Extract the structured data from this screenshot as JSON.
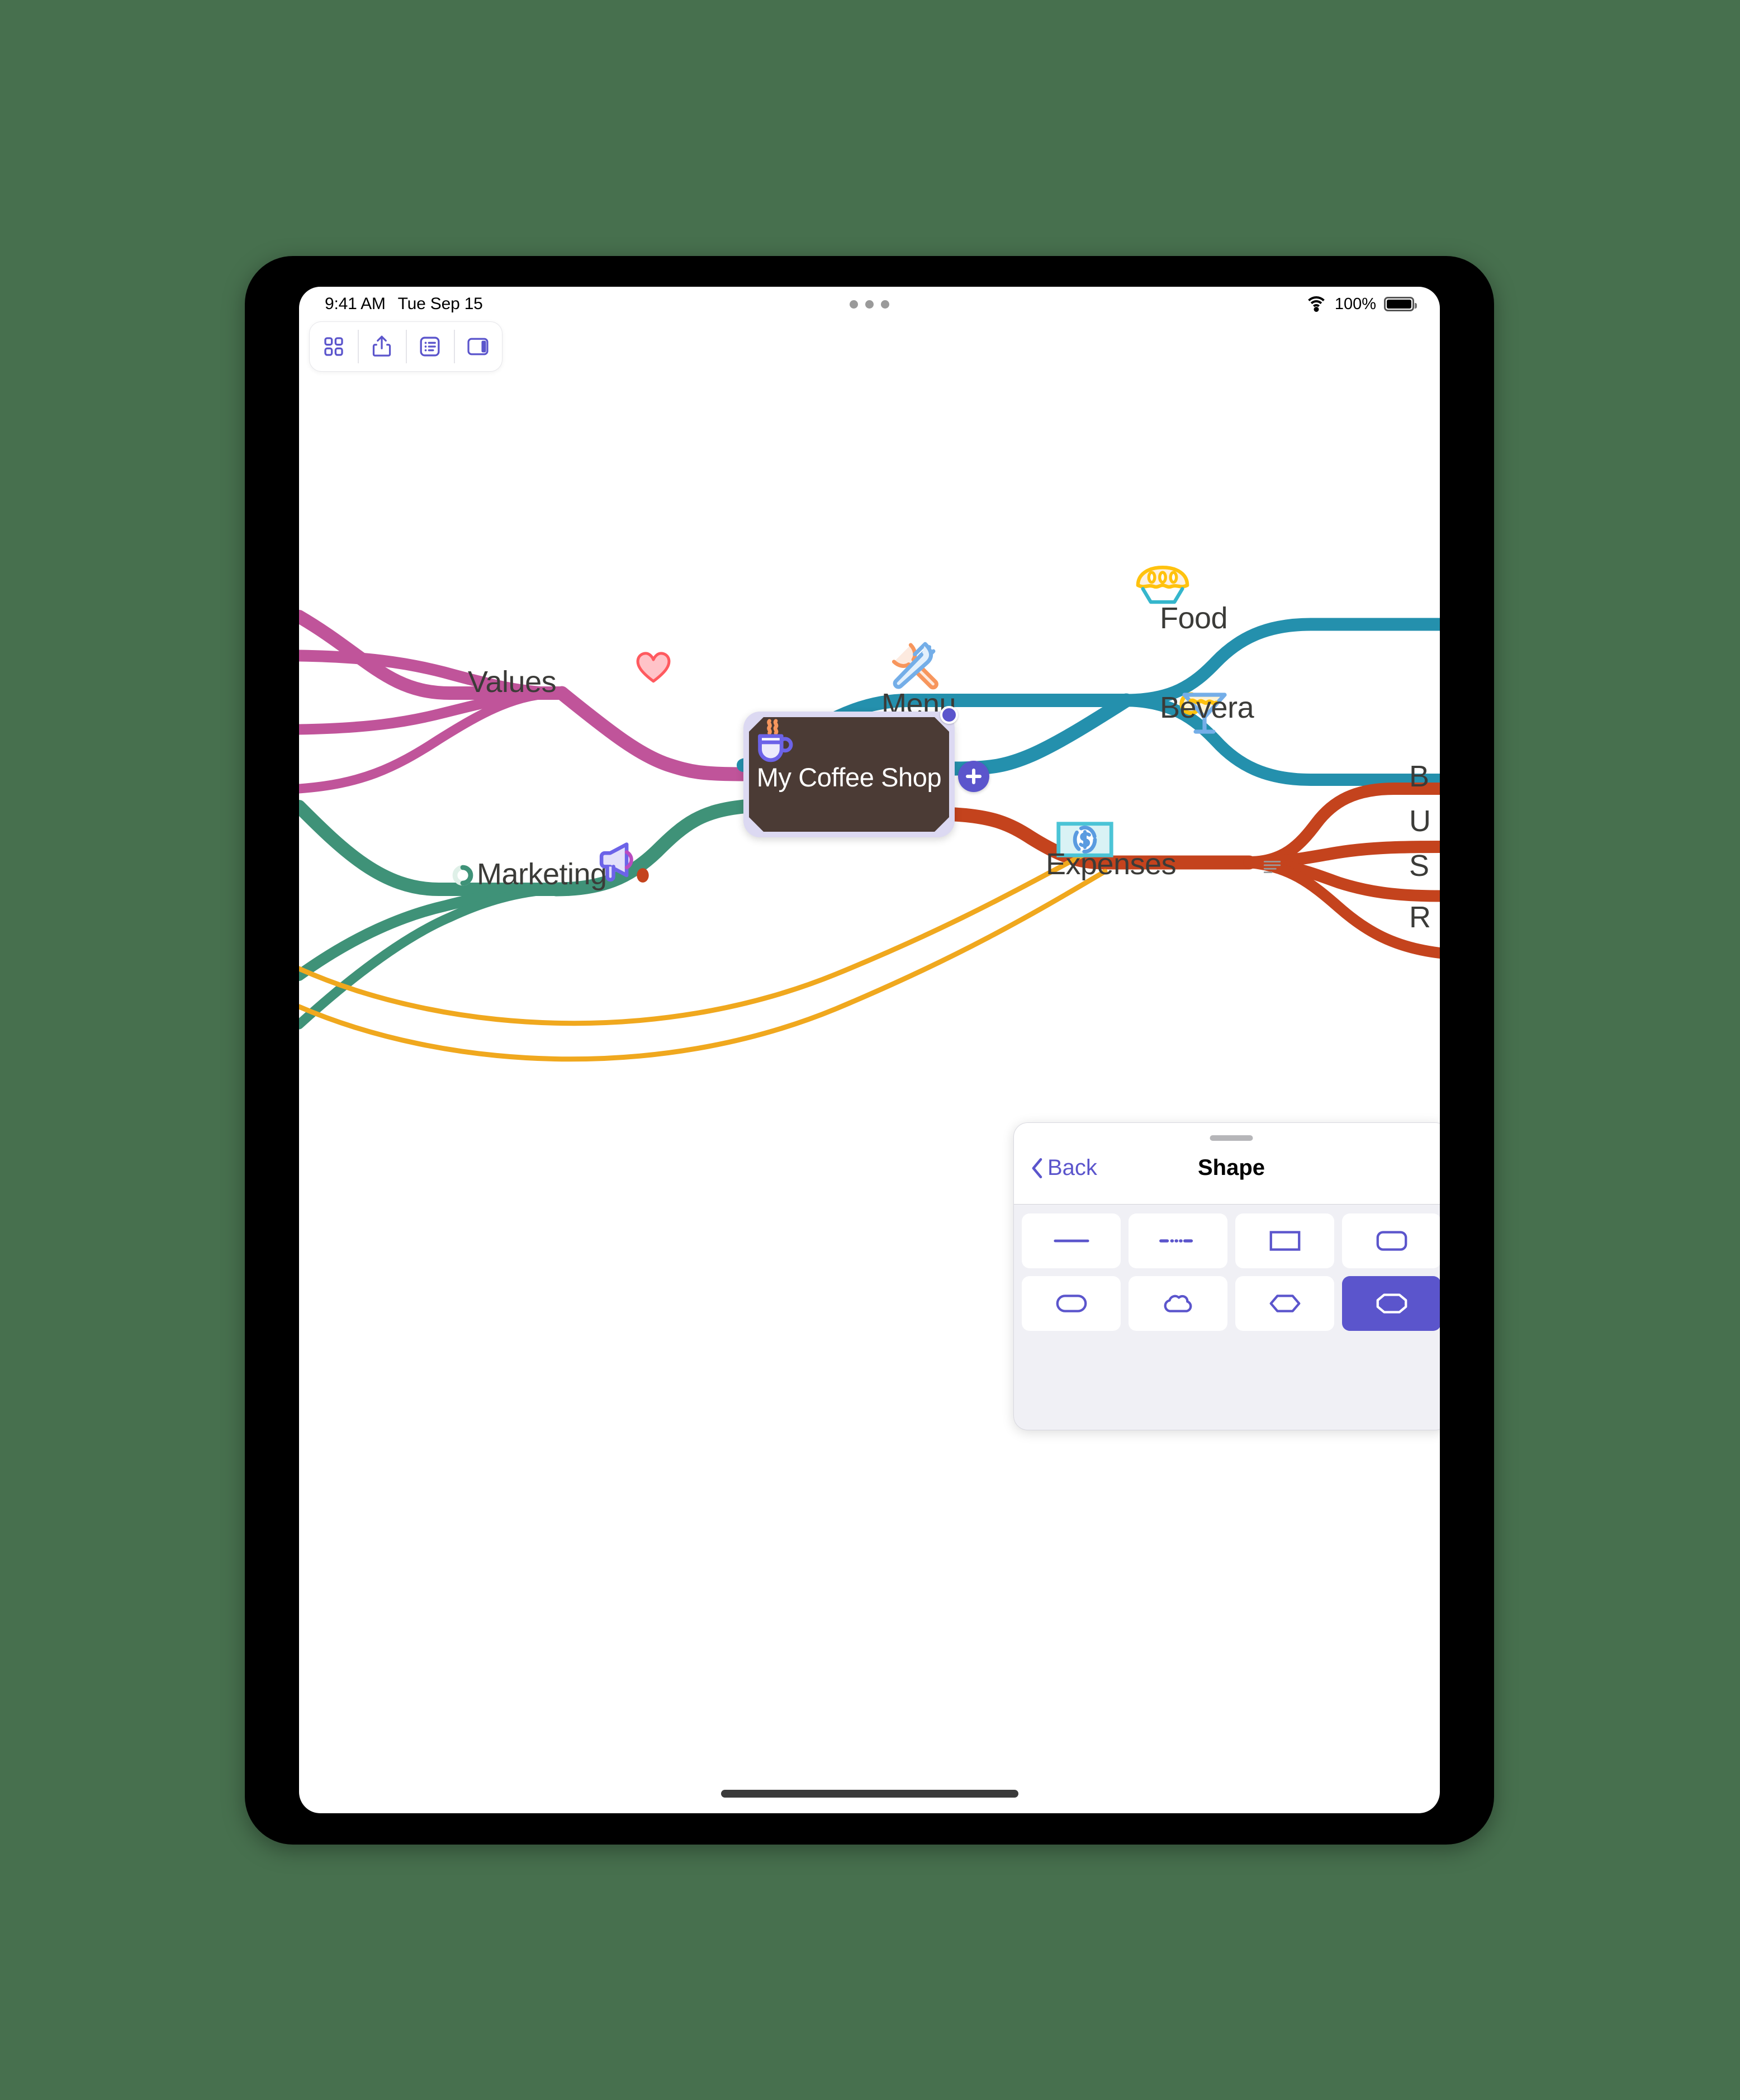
{
  "status_bar": {
    "time": "9:41 AM",
    "date": "Tue Sep 15",
    "battery_percent": "100%",
    "wifi_icon": "wifi-icon",
    "battery_icon": "battery-icon",
    "multitask_icon": "multitask-dots-icon"
  },
  "toolbar": {
    "items": [
      {
        "name": "documents-grid-button",
        "icon": "grid-icon"
      },
      {
        "name": "share-button",
        "icon": "share-icon"
      },
      {
        "name": "outline-button",
        "icon": "outline-list-icon"
      },
      {
        "name": "inspector-panel-button",
        "icon": "sidebar-panel-icon"
      }
    ]
  },
  "mindmap": {
    "central": {
      "title": "My Coffee Shop",
      "icon": "coffee-cup-icon",
      "fill": "#4b3b35",
      "selection_fill": "#dcd9f2",
      "shape": "octagon",
      "selected": true,
      "add_button_label": "+",
      "handle_icon": "drag-handle-dot"
    },
    "branches": [
      {
        "label": "Values",
        "icon": "heart-icon",
        "color": "#c0549a",
        "side": "left",
        "children_count": 4
      },
      {
        "label": "Marketing",
        "icon": "megaphone-icon",
        "color": "#3f9278",
        "side": "left",
        "children_count": 3,
        "progress_icon": "progress-ring-icon",
        "flag_icon": "red-dot-flag-icon"
      },
      {
        "label": "Menu",
        "icon": "fork-knife-icon",
        "color": "#2490ad",
        "side": "right",
        "children": [
          {
            "label": "Food",
            "icon": "pie-icon"
          },
          {
            "label": "Bevera",
            "icon": "cocktail-icon"
          }
        ]
      },
      {
        "label": "Expenses",
        "icon": "money-bill-icon",
        "color": "#c4431d",
        "side": "right",
        "note_icon": "note-lines-icon",
        "children": [
          {
            "label": "B"
          },
          {
            "label": "U"
          },
          {
            "label": "S"
          },
          {
            "label": "R"
          }
        ]
      }
    ],
    "relationship_links": {
      "color": "#f0a81e",
      "count": 2
    }
  },
  "shape_panel": {
    "back_label": "Back",
    "title": "Shape",
    "back_icon": "chevron-left-icon",
    "grabber_icon": "drag-grabber",
    "accent_color": "#5b55cc",
    "shapes": [
      {
        "name": "line",
        "icon": "line-shape-icon",
        "selected": false
      },
      {
        "name": "dash-dot-line",
        "icon": "dash-dot-line-shape-icon",
        "selected": false
      },
      {
        "name": "rectangle",
        "icon": "rectangle-shape-icon",
        "selected": false
      },
      {
        "name": "rounded-rectangle",
        "icon": "rounded-rectangle-shape-icon",
        "selected": false
      },
      {
        "name": "stadium",
        "icon": "stadium-shape-icon",
        "selected": false
      },
      {
        "name": "cloud",
        "icon": "cloud-shape-icon",
        "selected": false
      },
      {
        "name": "hexagon",
        "icon": "hexagon-shape-icon",
        "selected": false
      },
      {
        "name": "octagon",
        "icon": "octagon-shape-icon",
        "selected": true
      }
    ]
  }
}
